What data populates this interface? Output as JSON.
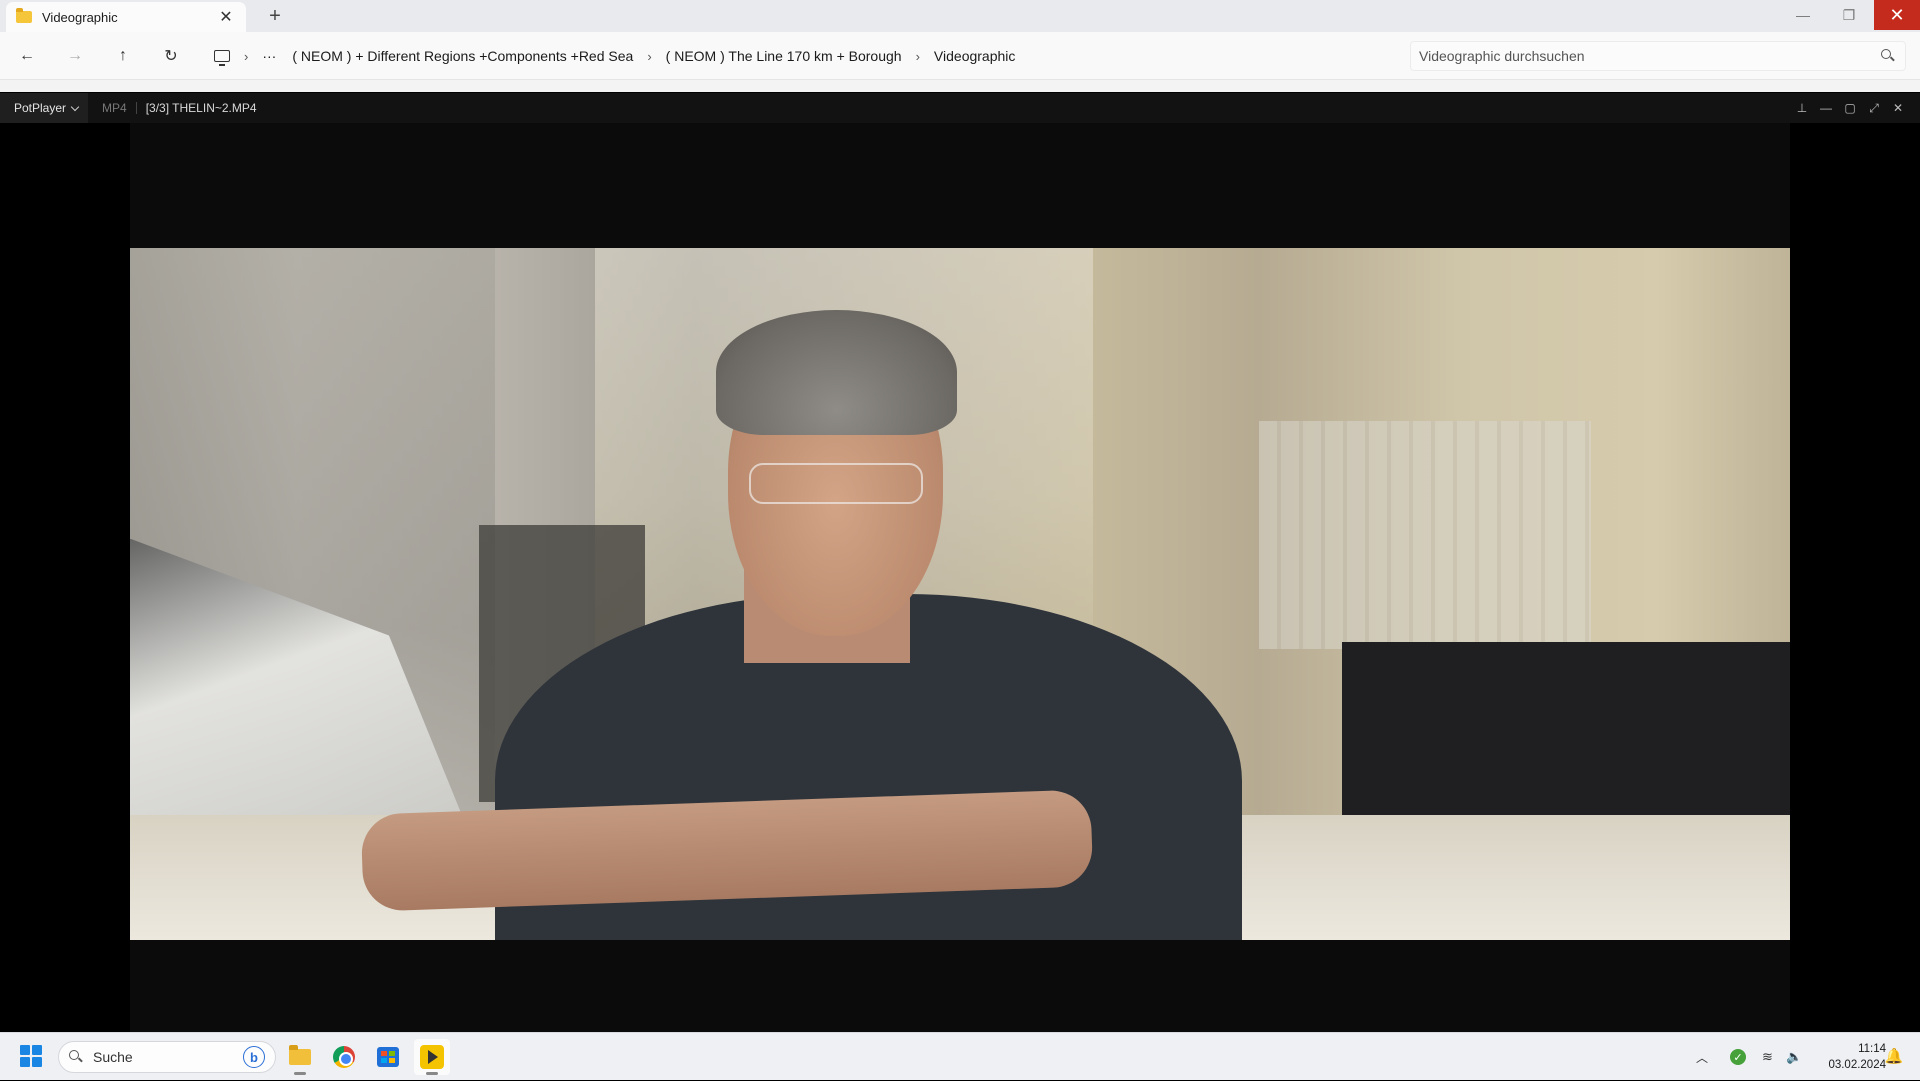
{
  "explorer": {
    "tab_title": "Videographic",
    "tab_close": "✕",
    "new_tab": "+",
    "window_controls": {
      "minimize": "—",
      "maximize": "❐",
      "close": "✕"
    },
    "nav": {
      "back": "←",
      "forward": "→",
      "up": "↑",
      "refresh": "↻",
      "more": "···"
    },
    "breadcrumbs": [
      "( NEOM ) + Different Regions +Components +Red Sea",
      "( NEOM ) The Line 170 km + Borough",
      "Videographic"
    ],
    "breadcrumb_separator": "›",
    "search_placeholder": "Videographic durchsuchen"
  },
  "potplayer": {
    "app_name": "PotPlayer",
    "format": "MP4",
    "file_label": "[3/3] THELIN~2.MP4",
    "controls": {
      "pin": "⊥",
      "minimize": "—",
      "maximize": "▢",
      "fullscreen": "⤢",
      "close": "✕"
    }
  },
  "taskbar": {
    "search_label": "Suche",
    "bing_label": "b",
    "apps": [
      "file-explorer",
      "chrome",
      "microsoft-store",
      "potplayer"
    ],
    "tray": {
      "chevron": "︿",
      "network": "≋",
      "volume": "🔈"
    },
    "time": "11:14",
    "date": "03.02.2024",
    "bell": "🔔"
  }
}
